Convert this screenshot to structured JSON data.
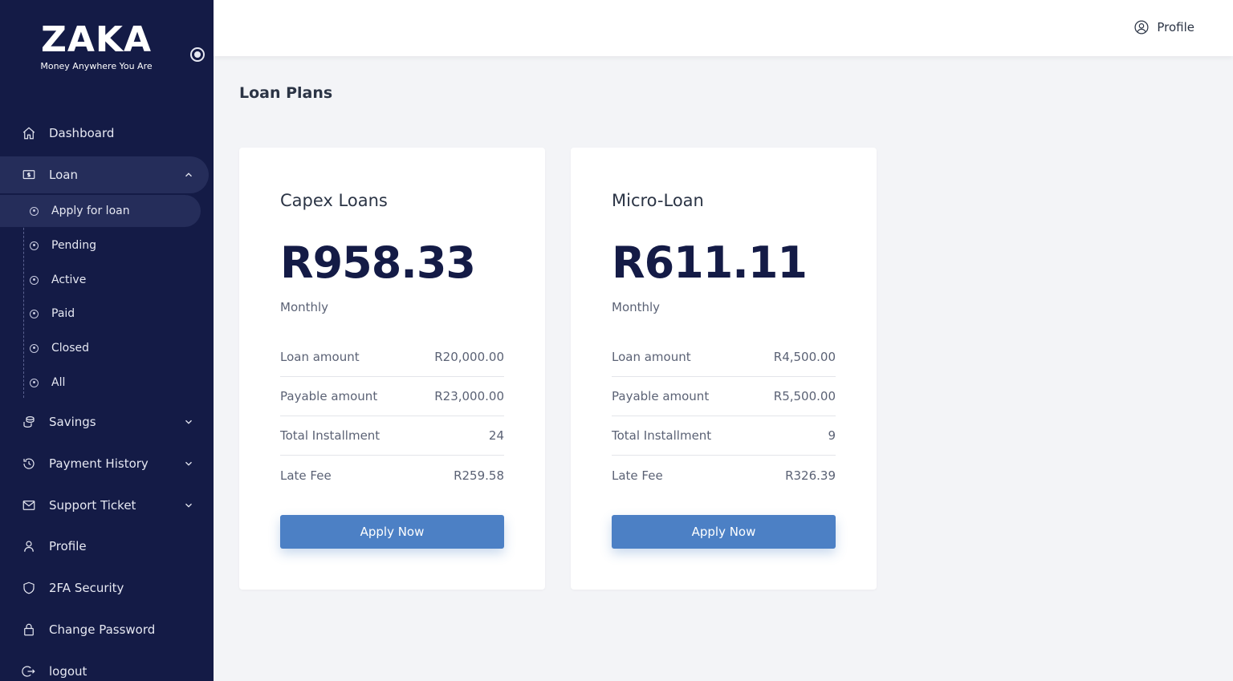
{
  "brand": {
    "logo": "ZAKA",
    "tagline": "Money Anywhere You Are"
  },
  "topbar": {
    "profile_label": "Profile"
  },
  "sidebar": {
    "items": [
      {
        "label": "Dashboard",
        "icon": "home-icon"
      },
      {
        "label": "Loan",
        "icon": "loan-icon",
        "expanded": true
      },
      {
        "label": "Savings",
        "icon": "savings-icon"
      },
      {
        "label": "Payment History",
        "icon": "history-icon"
      },
      {
        "label": "Support Ticket",
        "icon": "mail-icon"
      },
      {
        "label": "Profile",
        "icon": "user-icon"
      },
      {
        "label": "2FA Security",
        "icon": "shield-icon"
      },
      {
        "label": "Change Password",
        "icon": "lock-icon"
      },
      {
        "label": "logout",
        "icon": "logout-icon"
      }
    ],
    "loan_subitems": [
      "Apply for loan",
      "Pending",
      "Active",
      "Paid",
      "Closed",
      "All"
    ],
    "active_subitem": "Apply for loan"
  },
  "page": {
    "title": "Loan Plans"
  },
  "plans": [
    {
      "name": "Capex Loans",
      "price": "R958.33",
      "period": "Monthly",
      "rows": [
        {
          "label": "Loan amount",
          "value": "R20,000.00"
        },
        {
          "label": "Payable amount",
          "value": "R23,000.00"
        },
        {
          "label": "Total Installment",
          "value": "24"
        },
        {
          "label": "Late Fee",
          "value": "R259.58"
        }
      ],
      "button": "Apply Now"
    },
    {
      "name": "Micro-Loan",
      "price": "R611.11",
      "period": "Monthly",
      "rows": [
        {
          "label": "Loan amount",
          "value": "R4,500.00"
        },
        {
          "label": "Payable amount",
          "value": "R5,500.00"
        },
        {
          "label": "Total Installment",
          "value": "9"
        },
        {
          "label": "Late Fee",
          "value": "R326.39"
        }
      ],
      "button": "Apply Now"
    }
  ],
  "colors": {
    "sidebar_bg": "#141b46",
    "accent": "#4c80c5",
    "page_bg": "#f3f4f7"
  }
}
